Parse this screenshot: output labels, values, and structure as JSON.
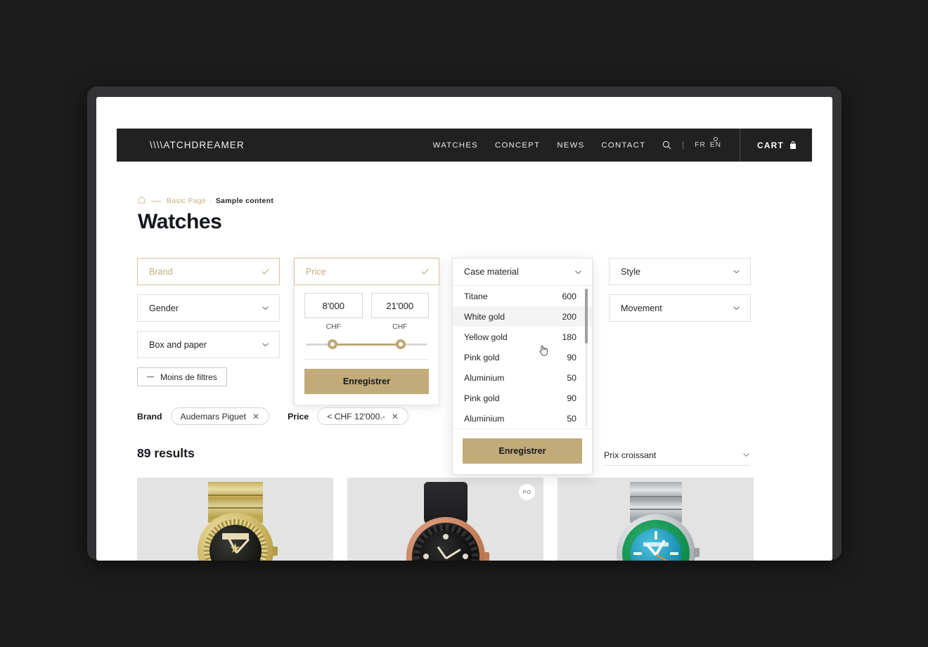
{
  "header": {
    "logo": "\\\\\\\\ATCHDREAMER",
    "nav": [
      {
        "label": "WATCHES"
      },
      {
        "label": "CONCEPT"
      },
      {
        "label": "NEWS"
      },
      {
        "label": "CONTACT"
      }
    ],
    "search_icon": "search-icon",
    "languages": [
      {
        "code": "FR",
        "active": false
      },
      {
        "code": "EN",
        "active": true
      }
    ],
    "cart_label": "CART",
    "cart_icon": "shopping-bag-icon",
    "background": "#212121"
  },
  "breadcrumb": {
    "home_icon": "home-icon",
    "crumb_1": "Basic Page",
    "separator": "·",
    "crumb_2": "Sample content"
  },
  "page_title": "Watches",
  "filters": {
    "brand": {
      "label": "Brand",
      "state": "selected",
      "icon": "check-icon"
    },
    "gender": {
      "label": "Gender",
      "icon": "chevron-down-icon"
    },
    "box_and_paper": {
      "label": "Box and paper",
      "icon": "chevron-down-icon"
    },
    "less_filters": {
      "label": "Moins de filtres",
      "icon": "minus-icon"
    },
    "price": {
      "label": "Price",
      "state": "selected",
      "icon": "check-icon",
      "min_value": "8'000",
      "max_value": "21'000",
      "min_unit": "CHF",
      "max_unit": "CHF",
      "save_label": "Enregistrer"
    },
    "case_material": {
      "label": "Case material",
      "icon": "chevron-down-icon",
      "open": true,
      "options": [
        {
          "name": "Titane",
          "count": "600",
          "hover": false
        },
        {
          "name": "White gold",
          "count": "200",
          "hover": true
        },
        {
          "name": "Yellow gold",
          "count": "180",
          "hover": false
        },
        {
          "name": "Pink gold",
          "count": "90",
          "hover": false
        },
        {
          "name": "Aluminium",
          "count": "50",
          "hover": false
        },
        {
          "name": "Pink gold",
          "count": "90",
          "hover": false
        },
        {
          "name": "Aluminium",
          "count": "50",
          "hover": false
        }
      ],
      "save_label": "Enregistrer"
    },
    "style": {
      "label": "Style",
      "icon": "chevron-down-icon"
    },
    "movement": {
      "label": "Movement",
      "icon": "chevron-down-icon"
    }
  },
  "active_filters": [
    {
      "group": "Brand",
      "value": "Audemars Piguet",
      "remove_icon": "close-icon"
    },
    {
      "group": "Price",
      "value": "< CHF 12'000.-",
      "remove_icon": "close-icon"
    }
  ],
  "results": {
    "count_label": "89 results",
    "sort_value": "Prix croissant",
    "sort_icon": "chevron-down-icon"
  },
  "products": [
    {
      "badge": null,
      "alt": "gold-watch"
    },
    {
      "badge": "PO",
      "alt": "rose-gold-watch"
    },
    {
      "badge": null,
      "alt": "steel-turquoise-watch"
    }
  ],
  "colors": {
    "gold": "#c1ac79",
    "gold_border": "#d2c19a",
    "header_dark": "#212121",
    "card_bg": "#e3e3e3"
  }
}
